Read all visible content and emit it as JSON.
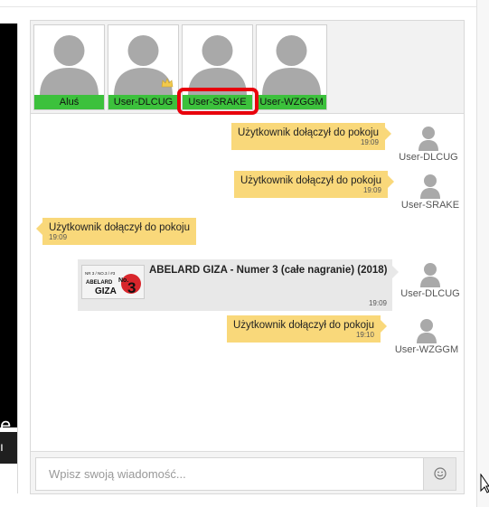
{
  "left_panel": {
    "video_char": "e",
    "button_char": "ı"
  },
  "users_bar": {
    "users": [
      {
        "name": "Aluś",
        "is_host": false
      },
      {
        "name": "User-DLCUG",
        "is_host": true
      },
      {
        "name": "User-SRAKE",
        "is_host": false,
        "highlighted": true
      },
      {
        "name": "User-WZGGM",
        "is_host": false
      }
    ]
  },
  "messages": [
    {
      "side": "right",
      "text": "Użytkownik dołączył do pokoju",
      "time": "19:09",
      "sender": "User-DLCUG"
    },
    {
      "side": "right",
      "text": "Użytkownik dołączył do pokoju",
      "time": "19:09",
      "sender": "User-SRAKE"
    },
    {
      "side": "left",
      "text": "Użytkownik dołączył do pokoju",
      "time": "19:09",
      "sender": ""
    },
    {
      "side": "right",
      "type": "video",
      "text": "ABELARD GIZA - Numer 3 (całe nagranie) (2018)",
      "time": "19:09",
      "sender": "User-DLCUG",
      "thumb_lines": [
        "NR 3 / NO.3 / #3",
        "ABELARD",
        "GIZA",
        "No.",
        "3"
      ]
    },
    {
      "side": "right",
      "text": "Użytkownik dołączył do pokoju",
      "time": "19:10",
      "sender": "User-WZGGM"
    }
  ],
  "composer": {
    "placeholder": "Wpisz swoją wiadomość..."
  },
  "colors": {
    "bubble": "#f9d87a",
    "name_bar": "#3cc13c",
    "highlight": "#e8000c",
    "video_bubble": "#e8e8e8"
  }
}
